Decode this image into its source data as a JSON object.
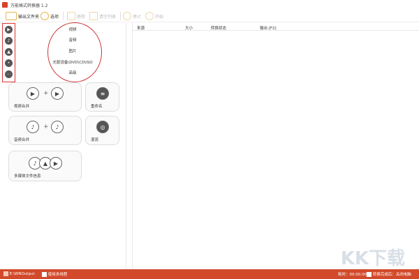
{
  "window": {
    "title": "万能格式转换器 1.2"
  },
  "toolbar": {
    "output_folder": "输出文件夹",
    "options": "选项",
    "remove": "移除",
    "clear_list": "清空列表",
    "stop": "停止",
    "start": "开始"
  },
  "sidebar": {
    "icons": [
      "video-icon",
      "music-icon",
      "image-icon",
      "disc-icon",
      "more-icon"
    ]
  },
  "menu": {
    "items": [
      "视频",
      "音频",
      "图片",
      "光驱设备\\DVD\\CD\\ISO",
      "高级"
    ]
  },
  "tiles": {
    "video_merge": "视频合并",
    "rename": "重命名",
    "audio_merge": "音频合并",
    "mix": "混流",
    "media_info": "多媒体文件信息"
  },
  "table": {
    "columns": [
      "来源",
      "大小",
      "转换状态",
      "输出 [F2]"
    ]
  },
  "status": {
    "output_path": "E:\\WNOutput",
    "multithread": "使用多线程",
    "elapsed": "耗时：00:00:00",
    "after_done": "转换完成后：关闭电脑"
  },
  "watermark": "KK下载",
  "colors": {
    "accent": "#d24a2b",
    "highlight": "#cc3333"
  }
}
